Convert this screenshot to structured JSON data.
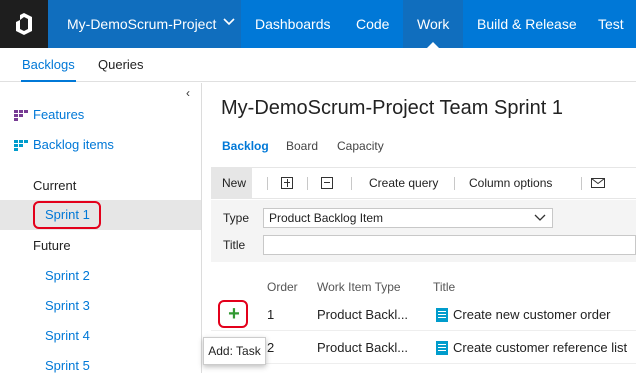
{
  "topnav": {
    "project": "My-DemoScrum-Project",
    "items": [
      "Dashboards",
      "Code",
      "Work",
      "Build & Release",
      "Test"
    ],
    "active": "Work"
  },
  "subnav": {
    "tabs": [
      "Backlogs",
      "Queries"
    ],
    "active": "Backlogs"
  },
  "sidebar": {
    "links": [
      "Features",
      "Backlog items"
    ],
    "current_heading": "Current",
    "current_sprint": "Sprint 1",
    "future_heading": "Future",
    "future_sprints": [
      "Sprint 2",
      "Sprint 3",
      "Sprint 4",
      "Sprint 5"
    ]
  },
  "main": {
    "title": "My-DemoScrum-Project Team Sprint 1",
    "tabs": [
      "Backlog",
      "Board",
      "Capacity"
    ],
    "active_tab": "Backlog",
    "toolbar": {
      "new": "New",
      "create_query": "Create query",
      "column_options": "Column options"
    },
    "form": {
      "type_label": "Type",
      "type_value": "Product Backlog Item",
      "title_label": "Title",
      "title_value": ""
    },
    "columns": [
      "Order",
      "Work Item Type",
      "Title"
    ],
    "rows": [
      {
        "order": "1",
        "type": "Product Backl...",
        "title": "Create new customer order"
      },
      {
        "order": "2",
        "type": "Product Backl...",
        "title": "Create customer reference list"
      }
    ],
    "add_button": "+",
    "tooltip": "Add: Task"
  },
  "colors": {
    "brand": "#0078d7",
    "highlight": "#e3001b",
    "add": "#339933"
  }
}
